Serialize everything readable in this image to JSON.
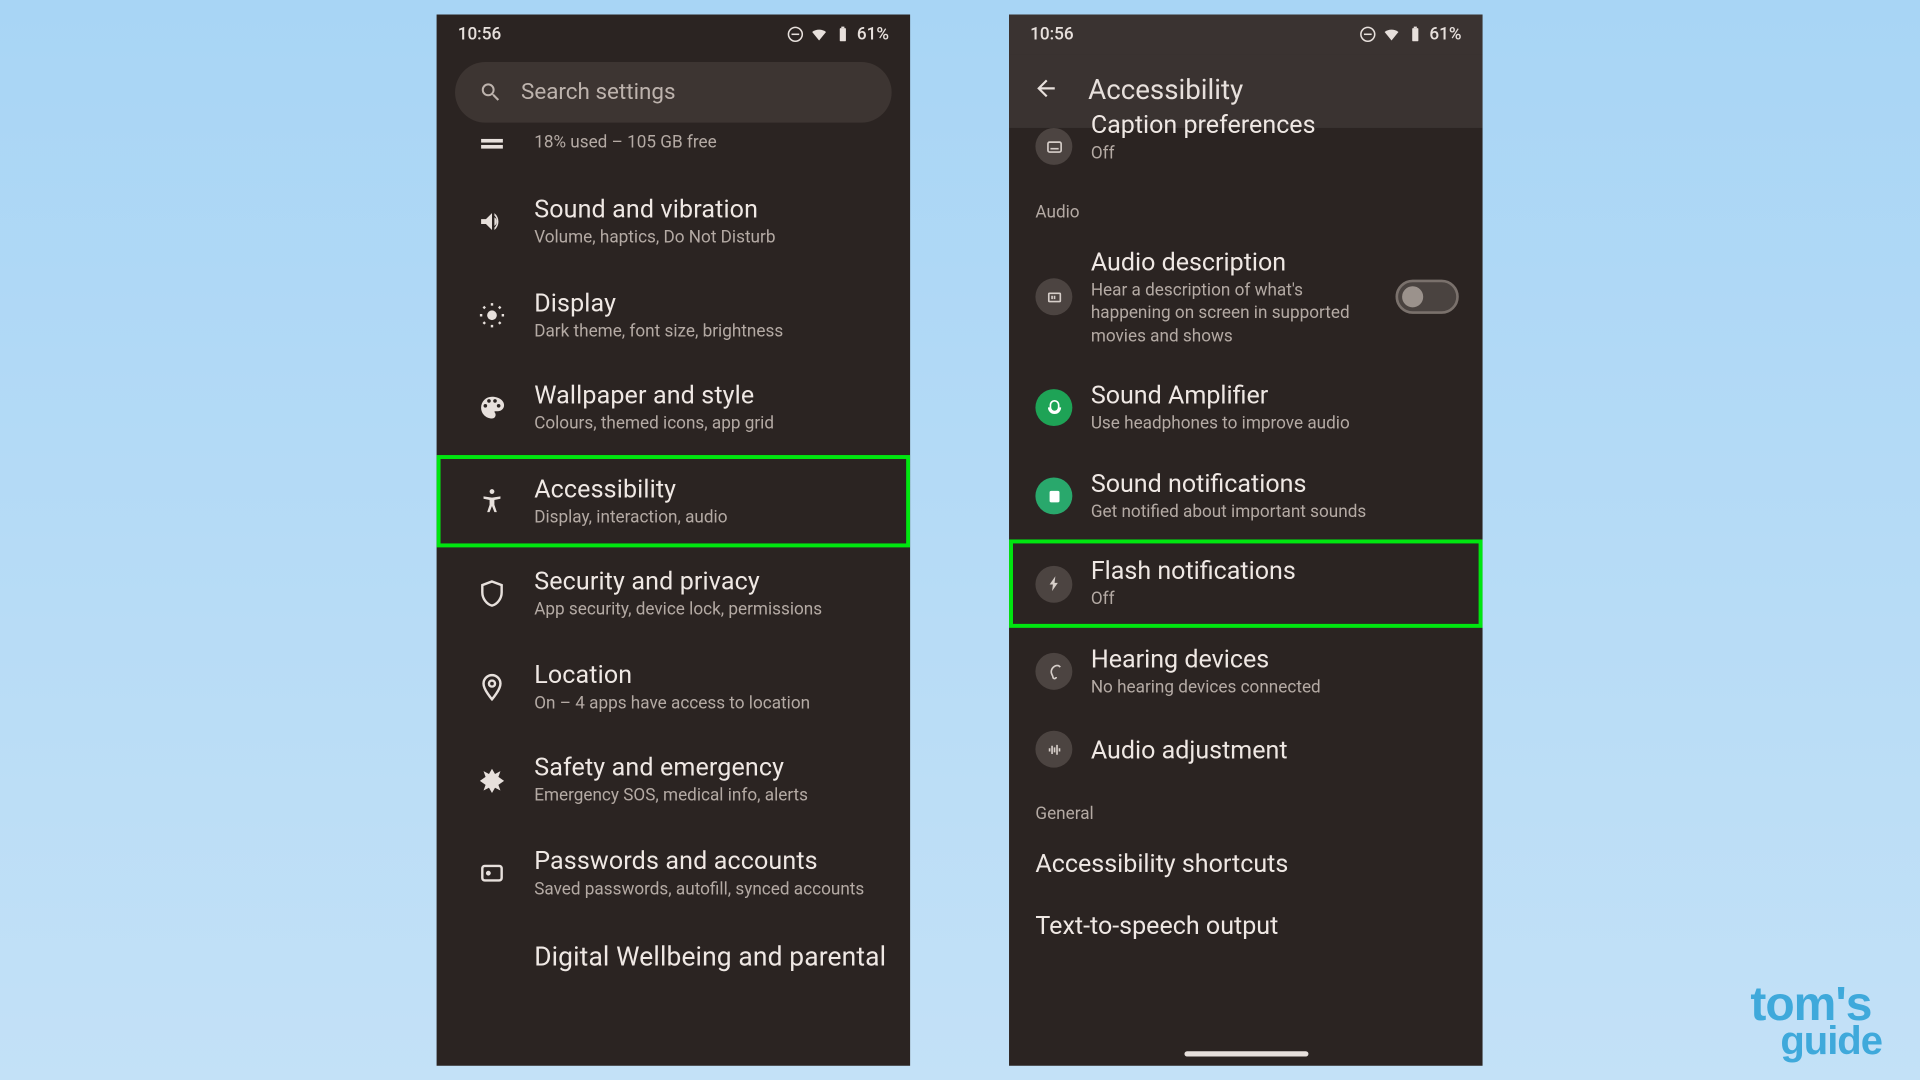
{
  "status": {
    "time": "10:56",
    "battery": "61%"
  },
  "leftPhone": {
    "search_placeholder": "Search settings",
    "storage_sub": "18% used – 105 GB free",
    "items": [
      {
        "title": "Sound and vibration",
        "sub": "Volume, haptics, Do Not Disturb"
      },
      {
        "title": "Display",
        "sub": "Dark theme, font size, brightness"
      },
      {
        "title": "Wallpaper and style",
        "sub": "Colours, themed icons, app grid"
      },
      {
        "title": "Accessibility",
        "sub": "Display, interaction, audio"
      },
      {
        "title": "Security and privacy",
        "sub": "App security, device lock, permissions"
      },
      {
        "title": "Location",
        "sub": "On – 4 apps have access to location"
      },
      {
        "title": "Safety and emergency",
        "sub": "Emergency SOS, medical info, alerts"
      },
      {
        "title": "Passwords and accounts",
        "sub": "Saved passwords, autofill, synced accounts"
      }
    ],
    "last_cut": "Digital Wellbeing and parental"
  },
  "rightPhone": {
    "appbar_title": "Accessibility",
    "caption_pref": {
      "title": "Caption preferences",
      "sub": "Off"
    },
    "section_audio": "Audio",
    "audio_desc": {
      "title": "Audio description",
      "sub": "Hear a description of what's happening on screen in supported movies and shows"
    },
    "sound_amp": {
      "title": "Sound Amplifier",
      "sub": "Use headphones to improve audio"
    },
    "sound_notif": {
      "title": "Sound notifications",
      "sub": "Get notified about important sounds"
    },
    "flash_notif": {
      "title": "Flash notifications",
      "sub": "Off"
    },
    "hearing": {
      "title": "Hearing devices",
      "sub": "No hearing devices connected"
    },
    "audio_adj": {
      "title": "Audio adjustment"
    },
    "section_general": "General",
    "a11y_shortcuts": "Accessibility shortcuts",
    "tts": "Text-to-speech output"
  },
  "watermark": {
    "l1": "tom's",
    "l2": "guide"
  }
}
